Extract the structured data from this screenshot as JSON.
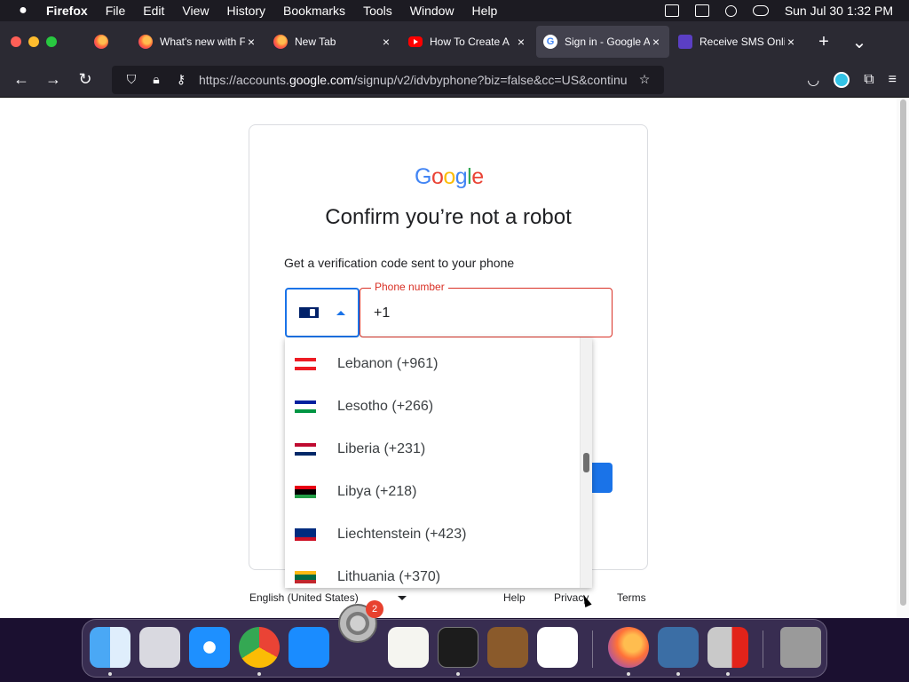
{
  "menubar": {
    "app_name": "Firefox",
    "menus": [
      "File",
      "Edit",
      "View",
      "History",
      "Bookmarks",
      "Tools",
      "Window",
      "Help"
    ],
    "datetime": "Sun Jul 30  1:32 PM"
  },
  "tabs": [
    {
      "title": "What's new with F",
      "favicon": "firefox-icon",
      "active": false
    },
    {
      "title": "New Tab",
      "favicon": "firefox-icon",
      "active": false
    },
    {
      "title": "How To Create A",
      "favicon": "youtube-icon",
      "active": false
    },
    {
      "title": "Sign in - Google A",
      "favicon": "google-icon",
      "active": true
    },
    {
      "title": "Receive SMS Onli",
      "favicon": "sms-site-icon",
      "active": false
    }
  ],
  "urlbar": {
    "prefix": "https://accounts.",
    "domain": "google.com",
    "suffix": "/signup/v2/idvbyphone?biz=false&cc=US&continu"
  },
  "card": {
    "logo_letters": [
      "G",
      "o",
      "o",
      "g",
      "l",
      "e"
    ],
    "title": "Confirm you’re not a robot",
    "subtitle": "Get a verification code sent to your phone",
    "phone_label": "Phone number",
    "phone_value": "+1"
  },
  "country_dropdown": {
    "items": [
      {
        "label": "Lebanon (+961)",
        "flag_colors": [
          "#ed1c24",
          "#ffffff",
          "#ed1c24"
        ]
      },
      {
        "label": "Lesotho (+266)",
        "flag_colors": [
          "#00209f",
          "#ffffff",
          "#009543"
        ]
      },
      {
        "label": "Liberia (+231)",
        "flag_colors": [
          "#bf0a30",
          "#ffffff",
          "#002868"
        ]
      },
      {
        "label": "Libya (+218)",
        "flag_colors": [
          "#e70013",
          "#000000",
          "#239e46"
        ]
      },
      {
        "label": "Liechtenstein (+423)",
        "flag_colors": [
          "#002b7f",
          "#002b7f",
          "#ce1126"
        ]
      },
      {
        "label": "Lithuania (+370)",
        "flag_colors": [
          "#fdb913",
          "#006a44",
          "#c1272d"
        ]
      }
    ]
  },
  "footer": {
    "language": "English (United States)",
    "links": [
      "Help",
      "Privacy",
      "Terms"
    ]
  },
  "dock": {
    "settings_badge": "2",
    "apps": [
      "finder-icon",
      "launchpad-icon",
      "safari-icon",
      "chrome-icon",
      "app-store-icon",
      "system-settings-icon",
      "textedit-icon",
      "terminal-icon",
      "garageband-icon",
      "vscode-icon",
      "firefox-icon",
      "virtualbox-icon",
      "parallels-icon",
      "trash-icon"
    ]
  }
}
